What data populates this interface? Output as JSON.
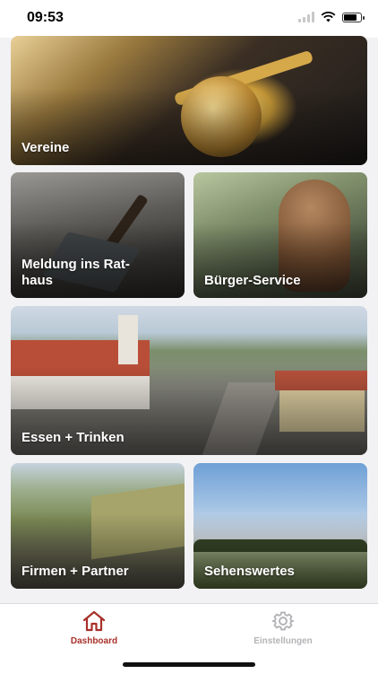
{
  "status_bar": {
    "time": "09:53",
    "icons": [
      "signal-icon",
      "wifi-icon",
      "battery-icon"
    ],
    "battery_level": 0.85
  },
  "tiles": [
    {
      "key": "vereine",
      "label": "Vereine",
      "image": "brass-instruments-photo"
    },
    {
      "key": "meldung",
      "label": "Meldung ins Rat-\nhaus",
      "image": "shovel-asphalt-photo"
    },
    {
      "key": "buerger",
      "label": "Bürger-Service",
      "image": "bronze-statue-photo"
    },
    {
      "key": "essen",
      "label": "Essen + Trinken",
      "image": "village-aerial-photo"
    },
    {
      "key": "firmen",
      "label": "Firmen + Partner",
      "image": "aerial-fields-photo"
    },
    {
      "key": "sehens",
      "label": "Sehenswertes",
      "image": "sky-landscape-photo"
    }
  ],
  "tab_bar": {
    "active": "dashboard",
    "accent_color": "#a8302a",
    "inactive_color": "#b4b4b8",
    "tabs": [
      {
        "label": "Dashboard",
        "icon": "home-icon"
      },
      {
        "label": "Einstellungen",
        "icon": "gear-icon"
      }
    ]
  }
}
